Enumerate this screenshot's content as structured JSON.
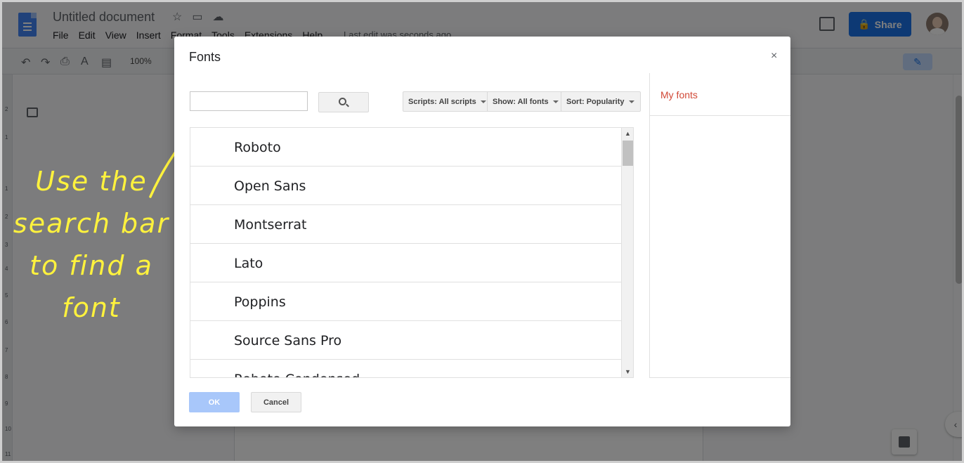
{
  "app": {
    "doc_title": "Untitled document",
    "menu": [
      "File",
      "Edit",
      "View",
      "Insert",
      "Format",
      "Tools",
      "Extensions",
      "Help"
    ],
    "last_edit": "Last edit was seconds ago",
    "share_label": "Share",
    "zoom": "100%",
    "ruler_numbers": [
      "2",
      "1",
      "1",
      "2",
      "3",
      "4",
      "5",
      "6",
      "7",
      "8",
      "9",
      "10",
      "11"
    ]
  },
  "dialog": {
    "title": "Fonts",
    "close_glyph": "×",
    "search": {
      "value": "",
      "placeholder": ""
    },
    "filters": {
      "scripts": "Scripts: All scripts",
      "show": "Show: All fonts",
      "sort": "Sort: Popularity"
    },
    "fonts": [
      "Roboto",
      "Open Sans",
      "Montserrat",
      "Lato",
      "Poppins",
      "Source Sans Pro",
      "Roboto Condensed"
    ],
    "my_fonts_label": "My fonts",
    "ok_label": "OK",
    "cancel_label": "Cancel"
  },
  "annotation": {
    "lines": [
      "Use the",
      "search bar",
      "to find a",
      "font"
    ],
    "color": "#fff23d"
  }
}
